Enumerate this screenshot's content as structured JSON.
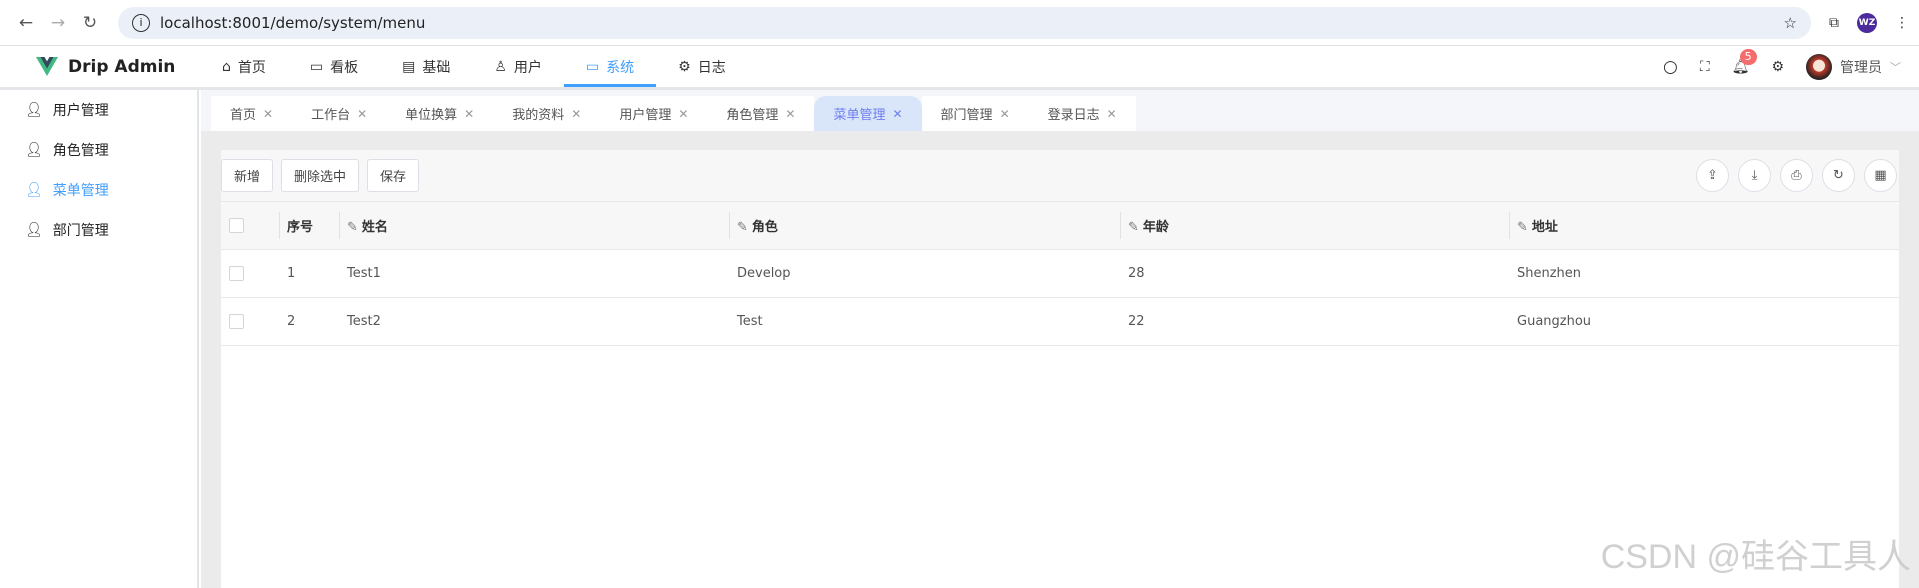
{
  "browser": {
    "url": "localhost:8001/demo/system/menu",
    "profile": "WZ"
  },
  "app": {
    "title": "Drip Admin",
    "brand_color": "#42b883",
    "accent": "#409eff"
  },
  "topmenu": [
    {
      "label": "首页",
      "icon": "home-icon"
    },
    {
      "label": "看板",
      "icon": "board-icon"
    },
    {
      "label": "基础",
      "icon": "card-icon"
    },
    {
      "label": "用户",
      "icon": "user-icon"
    },
    {
      "label": "系统",
      "icon": "monitor-icon",
      "active": true
    },
    {
      "label": "日志",
      "icon": "gear-icon"
    }
  ],
  "header": {
    "notifications": "5",
    "user": "管理员"
  },
  "sidebar": [
    {
      "label": "用户管理"
    },
    {
      "label": "角色管理"
    },
    {
      "label": "菜单管理",
      "active": true
    },
    {
      "label": "部门管理"
    }
  ],
  "tabs": [
    {
      "label": "首页"
    },
    {
      "label": "工作台"
    },
    {
      "label": "单位换算"
    },
    {
      "label": "我的资料"
    },
    {
      "label": "用户管理"
    },
    {
      "label": "角色管理"
    },
    {
      "label": "菜单管理",
      "active": true
    },
    {
      "label": "部门管理"
    },
    {
      "label": "登录日志"
    }
  ],
  "toolbar": {
    "add": "新增",
    "delete_selected": "删除选中",
    "save": "保存"
  },
  "table": {
    "columns": [
      "序号",
      "姓名",
      "角色",
      "年龄",
      "地址"
    ],
    "rows": [
      [
        "1",
        "Test1",
        "Develop",
        "28",
        "Shenzhen"
      ],
      [
        "2",
        "Test2",
        "Test",
        "22",
        "Guangzhou"
      ]
    ]
  },
  "watermark": "CSDN @硅谷工具人"
}
